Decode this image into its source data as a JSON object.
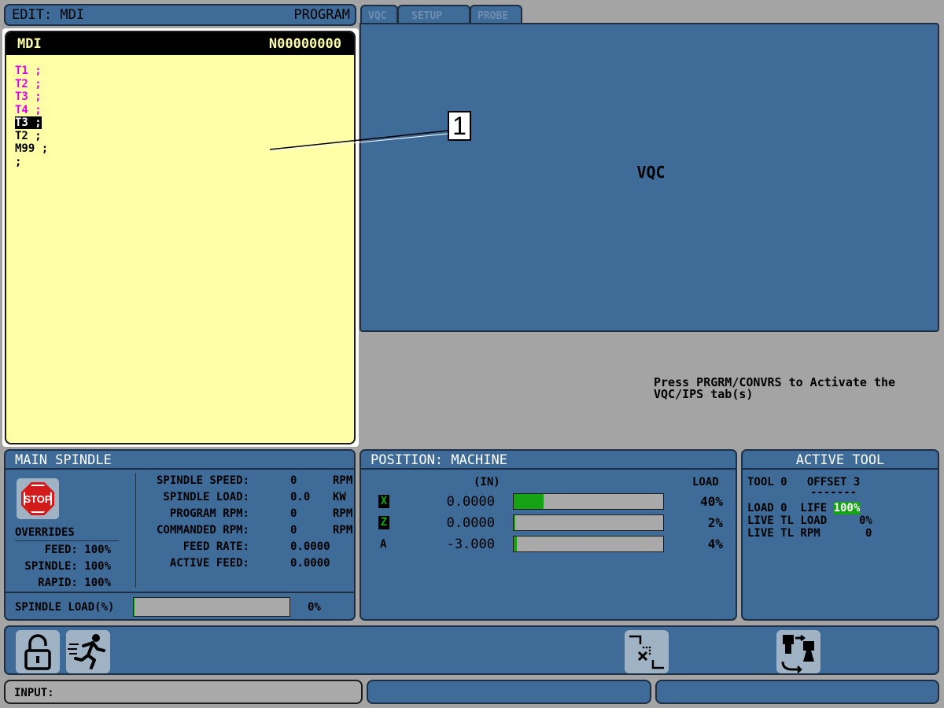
{
  "header": {
    "mode": "EDIT:  MDI",
    "title": "PROGRAM"
  },
  "program": {
    "name": "MDI",
    "number": "N00000000",
    "lines": [
      {
        "text": "T1 ;",
        "style": "mag"
      },
      {
        "text": "T2 ;",
        "style": "mag"
      },
      {
        "text": "T3 ;",
        "style": "mag"
      },
      {
        "text": "T4 ;",
        "style": "mag"
      },
      {
        "text": "T3 ;",
        "style": "sel"
      },
      {
        "text": "T2 ;",
        "style": "blk"
      },
      {
        "text": "M99 ;",
        "style": "blk"
      },
      {
        "text": ";",
        "style": "blk"
      }
    ]
  },
  "tabs": [
    {
      "label": "VQC",
      "active": true
    },
    {
      "label": "SETUP",
      "active": false
    },
    {
      "label": "PROBE",
      "active": false
    }
  ],
  "vqc": {
    "title": "VQC"
  },
  "annotation": {
    "label": "1"
  },
  "hint": {
    "line1": "Press PRGRM/CONVRS to Activate the",
    "line2": "VQC/IPS tab(s)"
  },
  "spindle": {
    "title": "MAIN SPINDLE",
    "stop_label": "STOP",
    "overrides_title": "OVERRIDES",
    "overrides": [
      {
        "label": "FEED:",
        "value": "100%"
      },
      {
        "label": "SPINDLE:",
        "value": "100%"
      },
      {
        "label": "RAPID:",
        "value": "100%"
      }
    ],
    "stats": [
      {
        "label": "SPINDLE SPEED:",
        "value": "0",
        "unit": "RPM"
      },
      {
        "label": "SPINDLE LOAD:",
        "value": "0.0",
        "unit": "KW"
      },
      {
        "label": "PROGRAM RPM:",
        "value": "0",
        "unit": "RPM"
      },
      {
        "label": "COMMANDED RPM:",
        "value": "0",
        "unit": "RPM"
      },
      {
        "label": "FEED RATE:",
        "value": "0.0000",
        "unit": ""
      },
      {
        "label": "ACTIVE FEED:",
        "value": "0.0000",
        "unit": ""
      }
    ],
    "load_label": "SPINDLE LOAD(%)",
    "load_value": "0%",
    "load_fraction": 0.005
  },
  "position": {
    "title": "POSITION:  MACHINE",
    "units": "(IN)",
    "load_header": "LOAD",
    "axes": [
      {
        "name": "X",
        "value": "0.0000",
        "load": "40%",
        "load_fraction": 0.2,
        "boxed": true
      },
      {
        "name": "Z",
        "value": "0.0000",
        "load": "2%",
        "load_fraction": 0.01,
        "boxed": true
      },
      {
        "name": "A",
        "value": "-3.000",
        "load": "4%",
        "load_fraction": 0.02,
        "boxed": false
      }
    ]
  },
  "active_tool": {
    "title": "ACTIVE TOOL",
    "tool_line": "TOOL 0   OFFSET 3",
    "dashes": "-------",
    "load_prefix": "LOAD 0  LIFE ",
    "life_value": "100%",
    "live_tl_load_label": "LIVE TL LOAD",
    "live_tl_load_value": "0%",
    "live_tl_rpm_label": "LIVE TL RPM",
    "live_tl_rpm_value": "0"
  },
  "toolbar": {
    "icons": [
      "unlock-icon",
      "running-man-icon",
      "tool-change-icon",
      "robot-swap-icon"
    ]
  },
  "status": {
    "input_label": "INPUT:"
  },
  "colors": {
    "panel": "#3f6b98",
    "program_bg": "#ffffa8",
    "magenta": "#e200e6",
    "green": "#15a315"
  }
}
